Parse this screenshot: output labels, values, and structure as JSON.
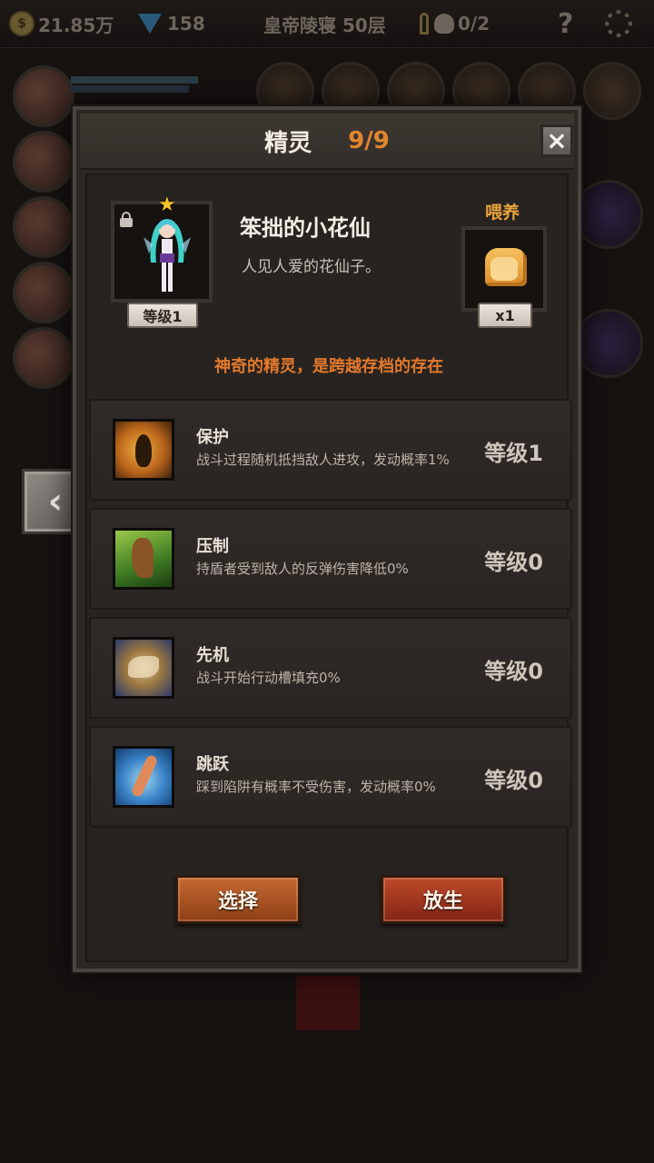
{
  "topbar": {
    "gold": "21.85万",
    "gems": "158",
    "location": "皇帝陵寝 50层",
    "keys_skulls": "0/2",
    "help": "?"
  },
  "panel": {
    "title": "精灵",
    "count": "9/9",
    "close": "×"
  },
  "spirit": {
    "name": "笨拙的小花仙",
    "description": "人见人爱的花仙子。",
    "level": "等级1",
    "note": "神奇的精灵，是跨越存档的存在"
  },
  "feed": {
    "label": "喂养",
    "quantity": "x1"
  },
  "skills": [
    {
      "name": "保护",
      "description": "战斗过程随机抵挡敌人进攻，发动概率1%",
      "level": "等级1",
      "icon": "shield-fairy-icon"
    },
    {
      "name": "压制",
      "description": "持盾者受到敌人的反弹伤害降低0%",
      "level": "等级0",
      "icon": "claw-icon"
    },
    {
      "name": "先机",
      "description": "战斗开始行动槽填充0%",
      "level": "等级0",
      "icon": "leopard-icon"
    },
    {
      "name": "跳跃",
      "description": "踩到陷阱有概率不受伤害，发动概率0%",
      "level": "等级0",
      "icon": "jump-icon"
    }
  ],
  "buttons": {
    "select": "选择",
    "release": "放生"
  },
  "back_arrow": "‹"
}
